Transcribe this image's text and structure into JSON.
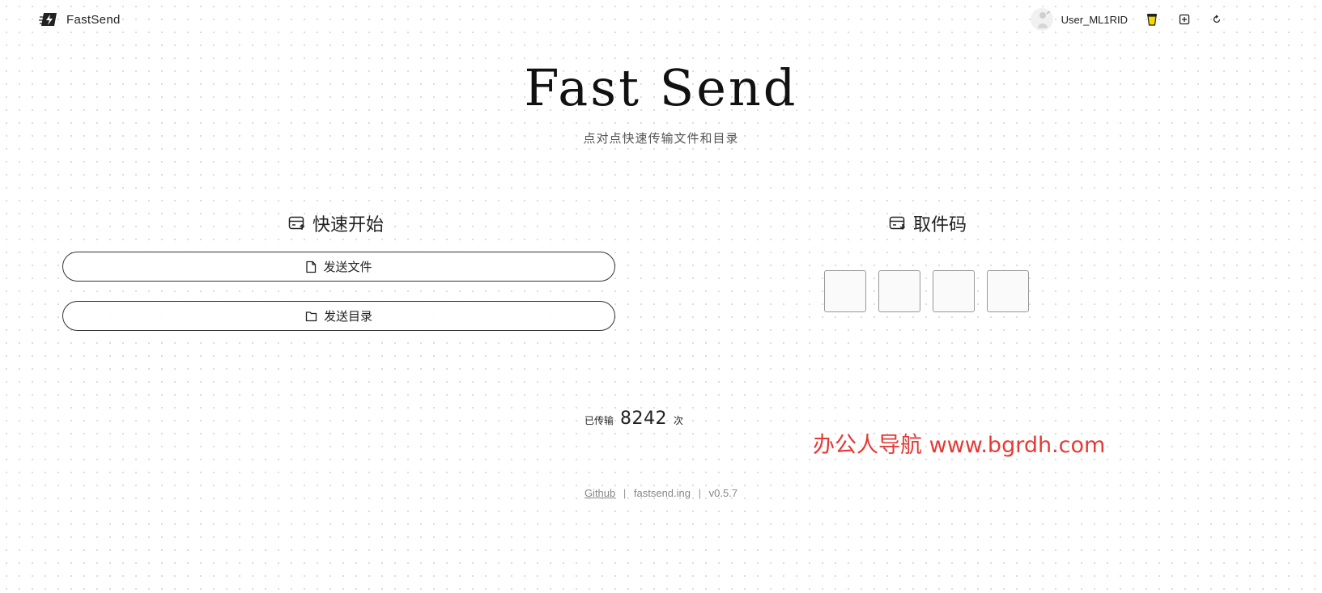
{
  "header": {
    "logo_text": "FastSend",
    "username": "User_ML1RID",
    "icons": [
      "lightning-logo-icon",
      "avatar-icon",
      "cup-icon",
      "expand-icon",
      "refresh-icon"
    ]
  },
  "hero": {
    "title": "Fast Send",
    "subtitle": "点对点快速传输文件和目录"
  },
  "quick_start": {
    "title": "快速开始",
    "send_file_label": "发送文件",
    "send_dir_label": "发送目录"
  },
  "pickup": {
    "title": "取件码",
    "codes": [
      "",
      "",
      "",
      ""
    ]
  },
  "stats": {
    "label": "已传输",
    "count": "8242",
    "unit": "次"
  },
  "watermark": "办公人导航 www.bgrdh.com",
  "footer": {
    "github": "Github",
    "site": "fastsend.ing",
    "version": "v0.5.7"
  },
  "colors": {
    "watermark": "#e53935",
    "accent": "#f5d800"
  }
}
